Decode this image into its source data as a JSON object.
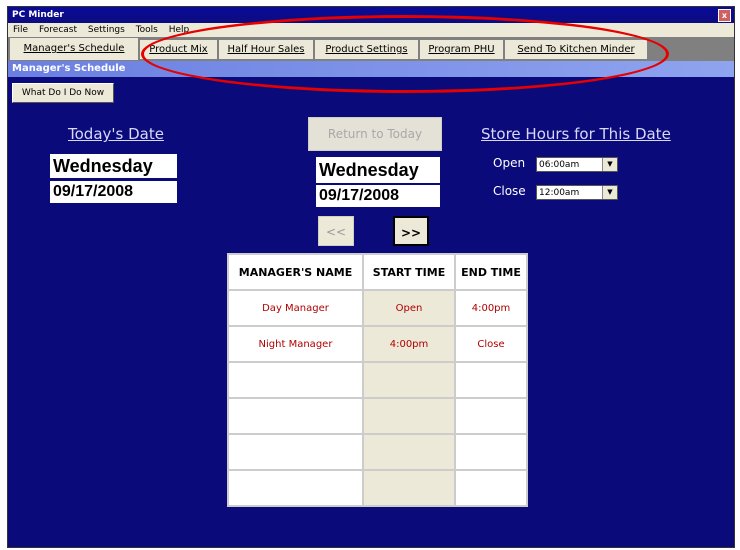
{
  "window": {
    "title": "PC Minder",
    "close_label": "x"
  },
  "menu": {
    "items": [
      "File",
      "Forecast",
      "Settings",
      "Tools",
      "Help"
    ]
  },
  "tabs": [
    {
      "label": "Manager's Schedule",
      "active": true
    },
    {
      "label": "Product Mix"
    },
    {
      "label": "Half Hour Sales"
    },
    {
      "label": "Product Settings"
    },
    {
      "label": "Program PHU"
    },
    {
      "label": "Send To Kitchen Minder"
    }
  ],
  "panel": {
    "title": "Manager's Schedule"
  },
  "what_do_i_do": "What Do I Do Now",
  "today": {
    "label": "Today's Date",
    "day": "Wednesday",
    "date": "09/17/2008"
  },
  "nav": {
    "return_label": "Return to Today",
    "day": "Wednesday",
    "date": "09/17/2008",
    "prev": "<<",
    "next": ">>"
  },
  "store_hours": {
    "label": "Store Hours for This Date",
    "open_label": "Open",
    "open_value": "06:00am",
    "close_label": "Close",
    "close_value": "12:00am"
  },
  "schedule": {
    "columns": [
      "MANAGER'S NAME",
      "START TIME",
      "END TIME"
    ],
    "rows": [
      [
        "Day Manager",
        "Open",
        "4:00pm"
      ],
      [
        "Night Manager",
        "4:00pm",
        "Close"
      ],
      [
        "",
        "",
        ""
      ],
      [
        "",
        "",
        ""
      ],
      [
        "",
        "",
        ""
      ],
      [
        "",
        "",
        ""
      ]
    ]
  },
  "colors": {
    "background": "#0a0a7a",
    "annotation_circle": "#e60000",
    "schedule_text": "#b00000"
  }
}
